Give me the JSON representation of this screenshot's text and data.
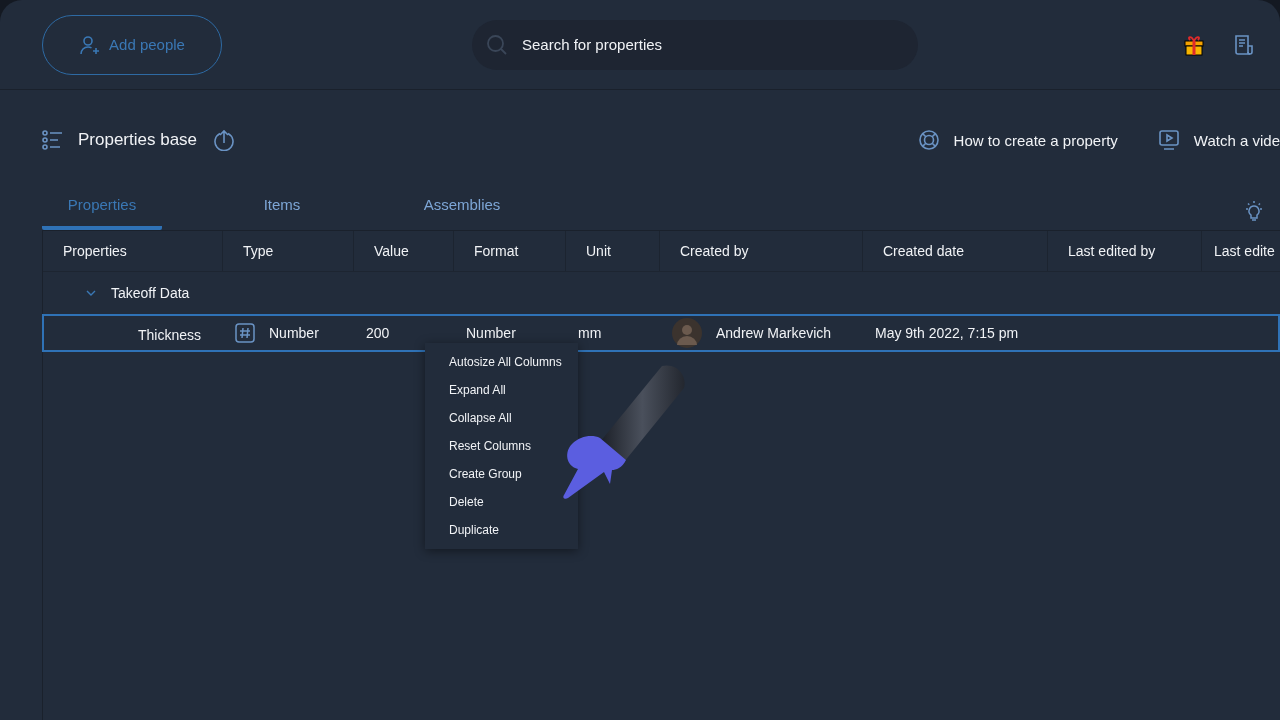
{
  "header": {
    "add_people": "Add people",
    "search": {
      "placeholder": "Search for properties"
    }
  },
  "toolbar": {
    "title": "Properties base",
    "links": [
      "How to create a property",
      "Watch a vide"
    ]
  },
  "tabs": [
    {
      "label": "Properties",
      "selected": true
    },
    {
      "label": "Items",
      "selected": false
    },
    {
      "label": "Assemblies",
      "selected": false
    }
  ],
  "table": {
    "columns": [
      "Properties",
      "Type",
      "Value",
      "Format",
      "Unit",
      "Created by",
      "Created date",
      "Last edited by",
      "Last edite"
    ],
    "groups": [
      {
        "name": "Takeoff Data",
        "expanded": true,
        "rows": [
          {
            "property": "Thickness",
            "type": "Number",
            "value": "200",
            "format": "Number",
            "unit": "mm",
            "created_by": "Andrew Markevich",
            "created_date": "May 9th 2022, 7:15 pm",
            "selected": true
          }
        ]
      }
    ]
  },
  "context_menu": [
    "Autosize All Columns",
    "Expand All",
    "Collapse All",
    "Reset Columns",
    "Create Group",
    "Delete",
    "Duplicate"
  ]
}
